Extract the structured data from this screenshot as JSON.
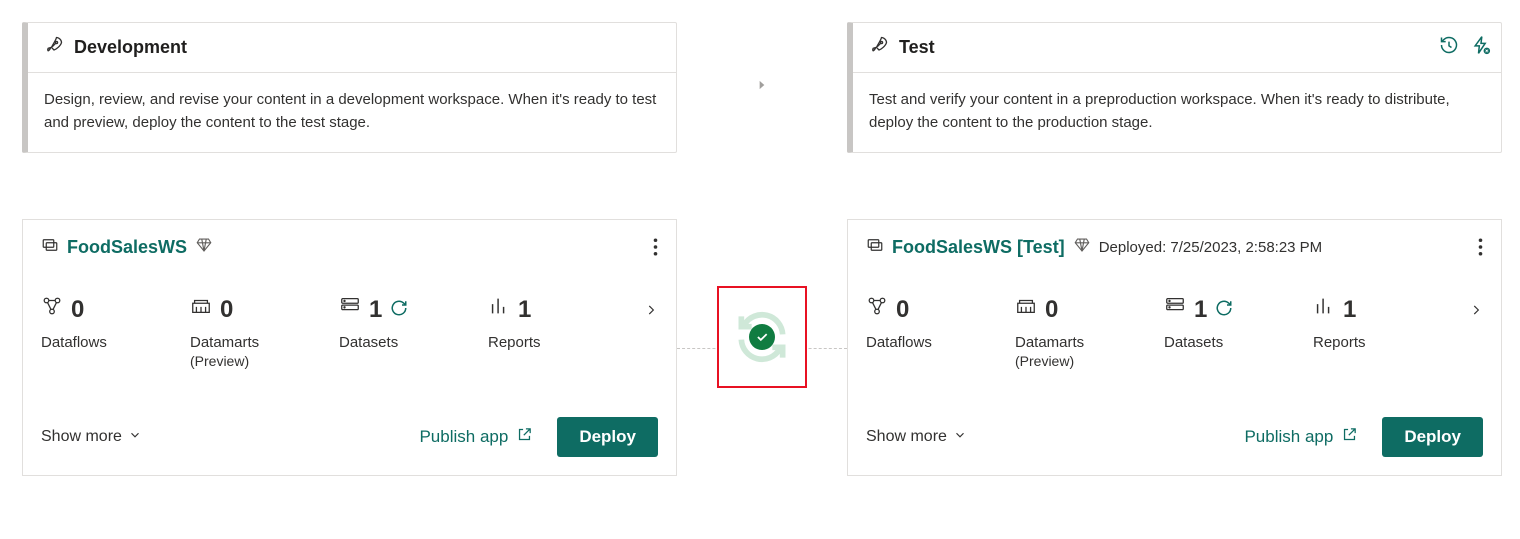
{
  "stages": {
    "dev": {
      "title": "Development",
      "description": "Design, review, and revise your content in a development workspace. When it's ready to test and preview, deploy the content to the test stage."
    },
    "test": {
      "title": "Test",
      "description": "Test and verify your content in a preproduction workspace. When it's ready to distribute, deploy the content to the production stage."
    }
  },
  "workspaces": {
    "dev": {
      "name": "FoodSalesWS",
      "stats": {
        "dataflows": {
          "value": "0",
          "label": "Dataflows"
        },
        "datamarts": {
          "value": "0",
          "label": "Datamarts",
          "sub": "(Preview)"
        },
        "datasets": {
          "value": "1",
          "label": "Datasets"
        },
        "reports": {
          "value": "1",
          "label": "Reports"
        }
      }
    },
    "test": {
      "name": "FoodSalesWS [Test]",
      "deployed": "Deployed: 7/25/2023, 2:58:23 PM",
      "stats": {
        "dataflows": {
          "value": "0",
          "label": "Dataflows"
        },
        "datamarts": {
          "value": "0",
          "label": "Datamarts",
          "sub": "(Preview)"
        },
        "datasets": {
          "value": "1",
          "label": "Datasets"
        },
        "reports": {
          "value": "1",
          "label": "Reports"
        }
      }
    }
  },
  "actions": {
    "show_more": "Show more",
    "publish_app": "Publish app",
    "deploy": "Deploy"
  }
}
